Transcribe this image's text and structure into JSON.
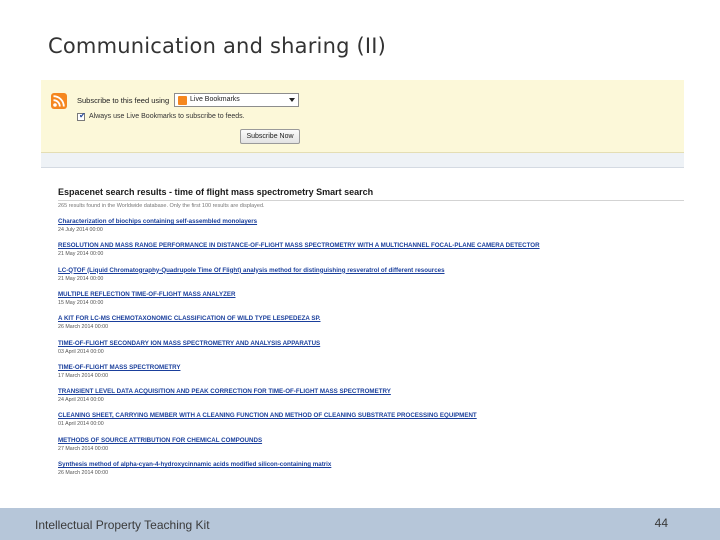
{
  "slide": {
    "title": "Communication and sharing (II)",
    "footer_left": "Intellectual Property Teaching Kit",
    "page_number": "44"
  },
  "subscribe": {
    "label": "Subscribe to this feed using",
    "feed_reader": "Live Bookmarks",
    "always_use_label": "Always use Live Bookmarks to subscribe to feeds.",
    "always_use_checked": true,
    "button": "Subscribe Now"
  },
  "results": {
    "title": "Espacenet search results - time of flight mass spectrometry Smart search",
    "note": "265 results found in the Worldwide database. Only the first 100 results are displayed.",
    "items": [
      {
        "title": "Characterization of biochips containing self-assembled monolayers",
        "date": "24 July 2014 00:00"
      },
      {
        "title": "RESOLUTION AND MASS RANGE PERFORMANCE IN DISTANCE-OF-FLIGHT MASS SPECTROMETRY WITH A MULTICHANNEL FOCAL-PLANE CAMERA DETECTOR",
        "date": "21 May 2014 00:00"
      },
      {
        "title": "LC-QTOF (Liquid Chromatography-Quadrupole Time Of Flight) analysis method for distinguishing resveratrol of different resources",
        "date": "21 May 2014 00:00"
      },
      {
        "title": "MULTIPLE REFLECTION TIME-OF-FLIGHT MASS ANALYZER",
        "date": "15 May 2014 00:00"
      },
      {
        "title": "A KIT FOR LC-MS CHEMOTAXONOMIC CLASSIFICATION OF WILD TYPE LESPEDEZA SP.",
        "date": "26 March 2014 00:00"
      },
      {
        "title": "TIME-OF-FLIGHT SECONDARY ION MASS SPECTROMETRY AND ANALYSIS APPARATUS",
        "date": "03 April 2014 00:00"
      },
      {
        "title": "TIME-OF-FLIGHT MASS SPECTROMETRY",
        "date": "17 March 2014 00:00"
      },
      {
        "title": "TRANSIENT LEVEL DATA ACQUISITION AND PEAK CORRECTION FOR TIME-OF-FLIGHT MASS SPECTROMETRY",
        "date": "24 April 2014 00:00"
      },
      {
        "title": "CLEANING SHEET, CARRYING MEMBER WITH A CLEANING FUNCTION AND METHOD OF CLEANING SUBSTRATE PROCESSING EQUIPMENT",
        "date": "01 April 2014 00:00"
      },
      {
        "title": "METHODS OF SOURCE ATTRIBUTION FOR CHEMICAL COMPOUNDS",
        "date": "27 March 2014 00:00"
      },
      {
        "title": "Synthesis method of alpha-cyan-4-hydroxycinnamic acids modified silicon-containing matrix",
        "date": "26 March 2014 00:00"
      }
    ]
  }
}
